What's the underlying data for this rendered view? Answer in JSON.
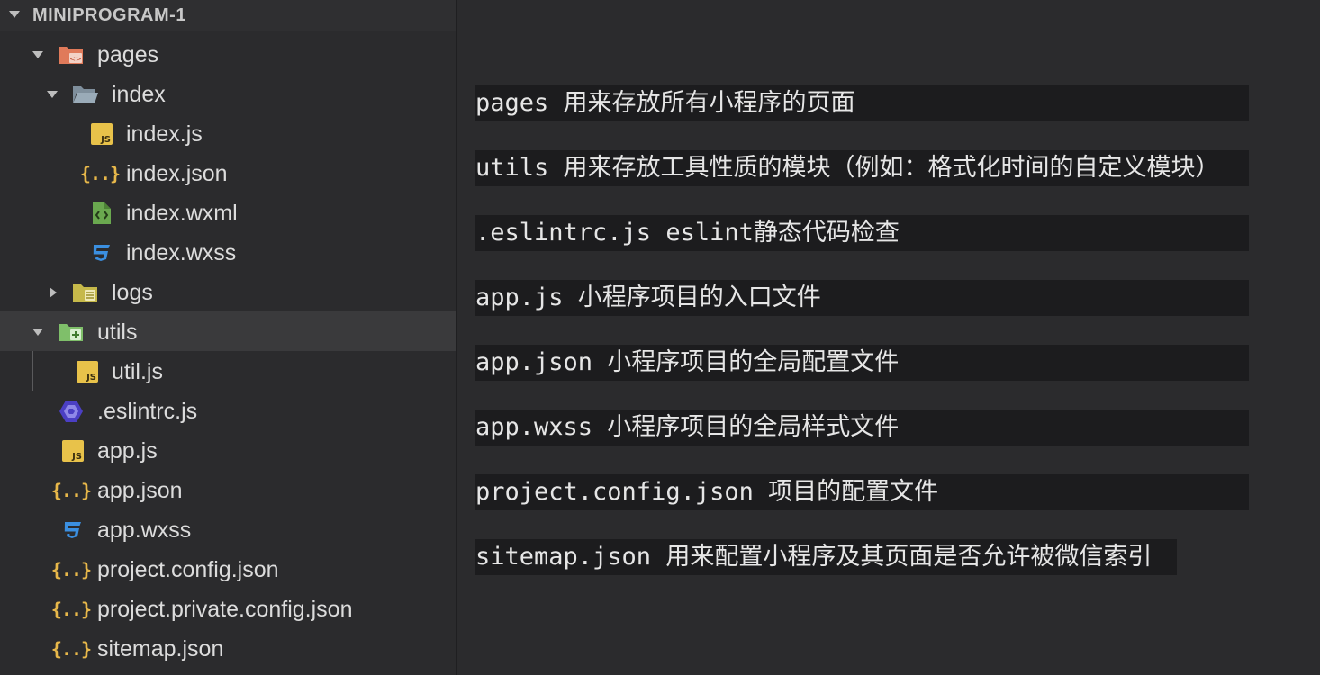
{
  "explorer": {
    "root_label": "MINIPROGRAM-1",
    "items": [
      {
        "label": "pages"
      },
      {
        "label": "index"
      },
      {
        "label": "index.js"
      },
      {
        "label": "index.json"
      },
      {
        "label": "index.wxml"
      },
      {
        "label": "index.wxss"
      },
      {
        "label": "logs"
      },
      {
        "label": "utils"
      },
      {
        "label": "util.js"
      },
      {
        "label": ".eslintrc.js"
      },
      {
        "label": "app.js"
      },
      {
        "label": "app.json"
      },
      {
        "label": "app.wxss"
      },
      {
        "label": "project.config.json"
      },
      {
        "label": "project.private.config.json"
      },
      {
        "label": "sitemap.json"
      }
    ],
    "selected": "utils"
  },
  "notes": [
    "pages 用来存放所有小程序的页面",
    "utils 用来存放工具性质的模块（例如：格式化时间的自定义模块）",
    ".eslintrc.js eslint静态代码检查",
    "app.js 小程序项目的入口文件",
    "app.json 小程序项目的全局配置文件",
    "app.wxss 小程序项目的全局样式文件",
    "project.config.json 项目的配置文件",
    "sitemap.json 用来配置小程序及其页面是否允许被微信索引"
  ],
  "icons": {
    "js": "JS",
    "json": "{..}"
  },
  "colors": {
    "sidebar_bg": "#2b2b2d",
    "selected_row": "#3a3a3c",
    "note_bg": "#1c1c1e",
    "js_icon": "#e8c24a",
    "json_icon": "#e8b84a",
    "css_icon": "#3b8fe0",
    "wxml_icon": "#6aa84f",
    "pages_folder": "#e07a5a",
    "index_folder": "#8a9aa8",
    "logs_folder": "#c6b94a",
    "utils_folder": "#7fbf6a",
    "eslint_icon": "#4b3fc4"
  }
}
